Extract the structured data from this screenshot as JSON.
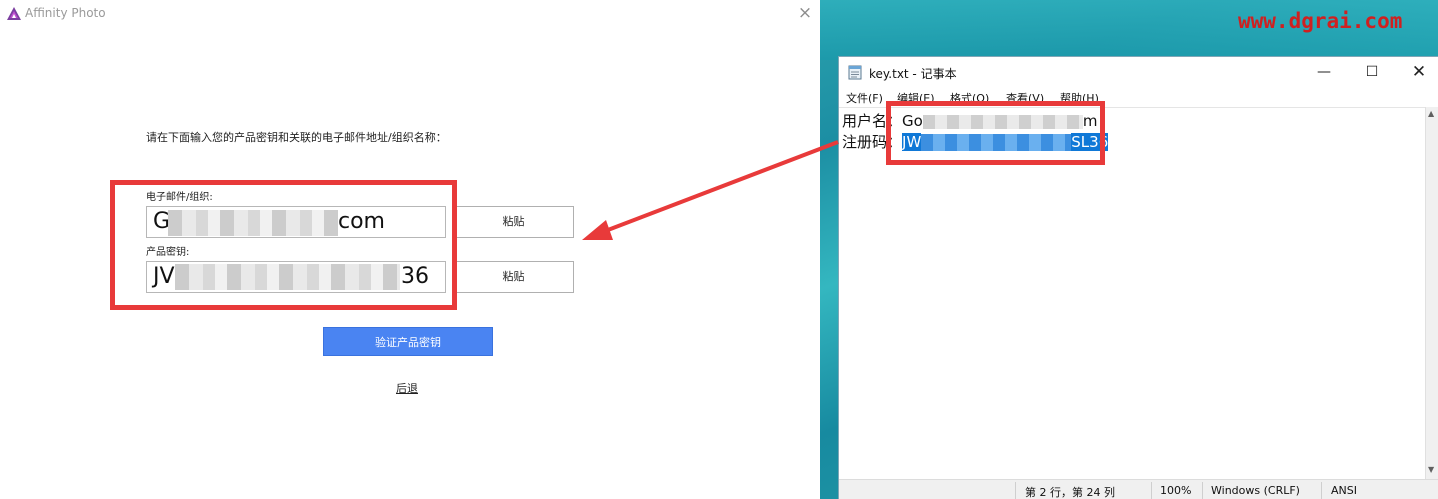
{
  "affinity": {
    "title": "Affinity Photo",
    "instruction": "请在下面输入您的产品密钥和关联的电子邮件地址/组织名称：",
    "email_label": "电子邮件/组织:",
    "email_value_start": "G",
    "email_value_end": "com",
    "key_label": "产品密钥:",
    "key_value_start": "JV",
    "key_value_end": "36",
    "paste_label": "粘贴",
    "verify_label": "验证产品密钥",
    "back_label": "后退"
  },
  "watermark": "www.dgrai.com",
  "notepad": {
    "title": "key.txt - 记事本",
    "menus": [
      "文件(F)",
      "编辑(E)",
      "格式(O)",
      "查看(V)",
      "帮助(H)"
    ],
    "line1_label": "用户名：",
    "line1_value_start": "Go",
    "line1_value_end": "m",
    "line2_label": "注册码：",
    "line2_value_start": "JW",
    "line2_value_end": "SL36",
    "status_position": "第 2 行，第 24 列",
    "status_zoom": "100%",
    "status_eol": "Windows (CRLF)",
    "status_encoding": "ANSI"
  },
  "colors": {
    "highlight_red": "#e83a3a",
    "verify_blue": "#4a84f2",
    "selection_blue": "#0f78d7"
  }
}
